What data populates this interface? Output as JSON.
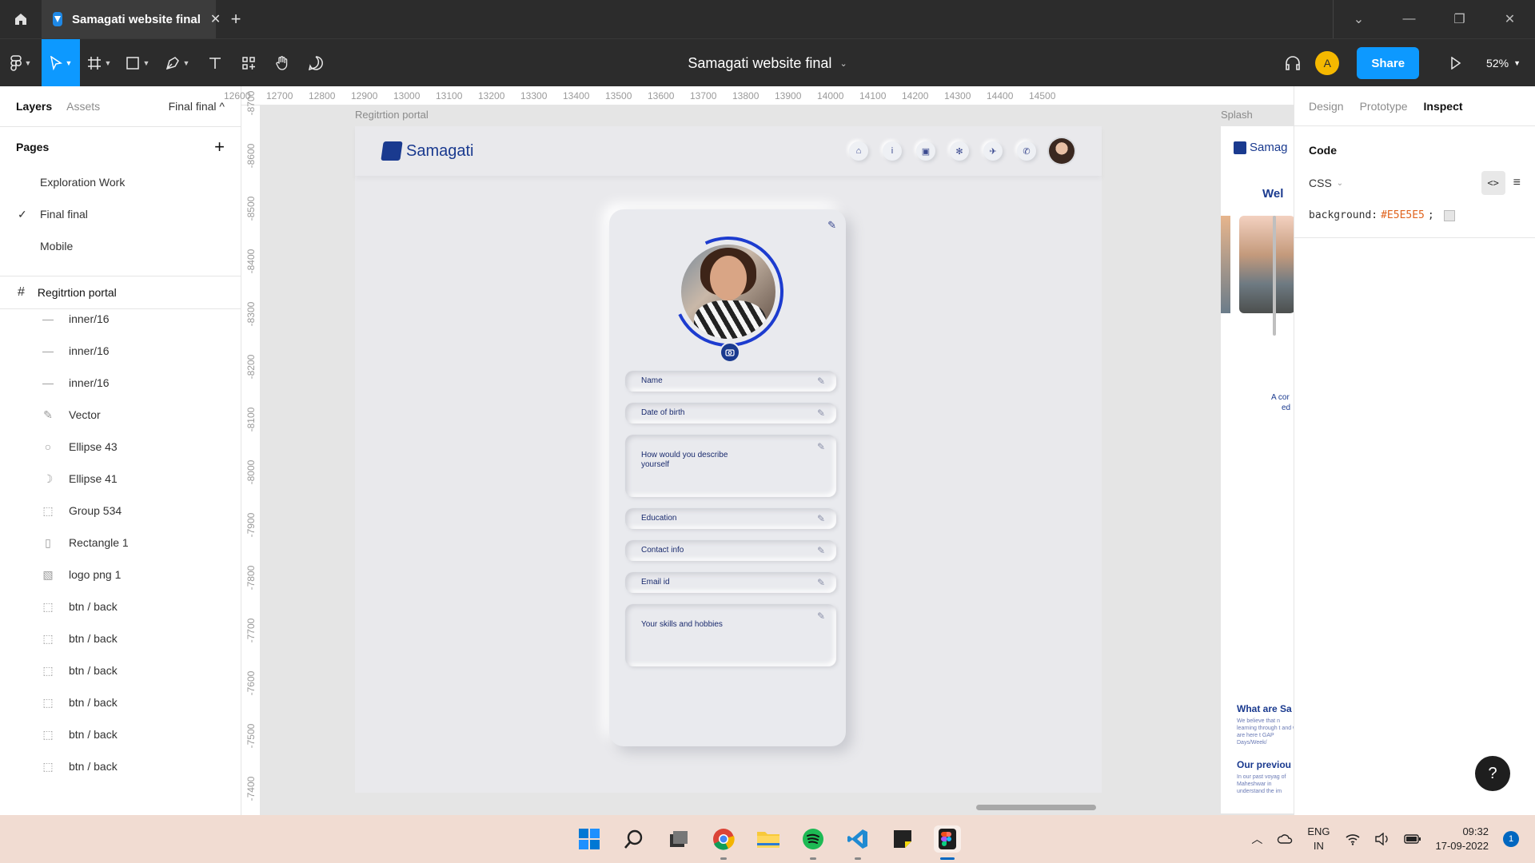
{
  "window": {
    "tab_title": "Samagati website final",
    "tab_close": "✕",
    "new_tab": "+",
    "controls": [
      "⌄",
      "—",
      "❐",
      "✕"
    ]
  },
  "toolbar": {
    "doc_title": "Samagati website final",
    "avatar_initial": "A",
    "share_label": "Share",
    "zoom": "52%"
  },
  "left_panel": {
    "tabs": [
      "Layers",
      "Assets"
    ],
    "page_selector": "Final final ^",
    "pages_header": "Pages",
    "pages": [
      {
        "label": "Exploration Work",
        "selected": false
      },
      {
        "label": "Final final",
        "selected": true
      },
      {
        "label": "Mobile",
        "selected": false
      }
    ],
    "frame_name": "Regitrtion portal",
    "layers": [
      {
        "label": "inner/16",
        "icon": "line-icon"
      },
      {
        "label": "inner/16",
        "icon": "line-icon"
      },
      {
        "label": "inner/16",
        "icon": "line-icon"
      },
      {
        "label": "Vector",
        "icon": "pen-icon"
      },
      {
        "label": "Ellipse 43",
        "icon": "ellipse-icon"
      },
      {
        "label": "Ellipse 41",
        "icon": "arc-icon"
      },
      {
        "label": "Group 534",
        "icon": "group-icon"
      },
      {
        "label": "Rectangle 1",
        "icon": "rectangle-icon"
      },
      {
        "label": "logo png 1",
        "icon": "image-icon"
      },
      {
        "label": "btn / back",
        "icon": "group-icon"
      },
      {
        "label": "btn / back",
        "icon": "group-icon"
      },
      {
        "label": "btn / back",
        "icon": "group-icon"
      },
      {
        "label": "btn / back",
        "icon": "group-icon"
      },
      {
        "label": "btn / back",
        "icon": "group-icon"
      },
      {
        "label": "btn / back",
        "icon": "group-icon"
      }
    ]
  },
  "rulers": {
    "top": [
      "12600",
      "12700",
      "12800",
      "12900",
      "13000",
      "13100",
      "13200",
      "13300",
      "13400",
      "13500",
      "13600",
      "13700",
      "13800",
      "13900",
      "14000",
      "14100",
      "14200",
      "14300",
      "14400",
      "14500"
    ],
    "left": [
      "-8700",
      "-8600",
      "-8500",
      "-8400",
      "-8300",
      "-8200",
      "-8100",
      "-8000",
      "-7900",
      "-7800",
      "-7700",
      "-7600",
      "-7500",
      "-7400"
    ]
  },
  "canvas": {
    "frame_label": "Regitrtion portal",
    "frame2_label": "Splash",
    "background": "#E5E5E5",
    "site": {
      "logo_text": "Samagati",
      "nav_icons": [
        "home-icon",
        "info-icon",
        "gallery-icon",
        "community-icon",
        "travel-icon",
        "phone-icon"
      ],
      "fields": [
        {
          "label": "Name",
          "tall": false
        },
        {
          "label": "Date of birth",
          "tall": false
        },
        {
          "label": "How would you describe yourself",
          "tall": true
        },
        {
          "label": "Education",
          "tall": false
        },
        {
          "label": "Contact info",
          "tall": false
        },
        {
          "label": "Email id",
          "tall": false
        },
        {
          "label": "Your skills and hobbies",
          "tall": true
        }
      ]
    },
    "splash_texts": [
      "Samag",
      "Wel",
      "A cor",
      "ed",
      "What are Sa",
      "We believe that n learning through t and we are here t GAP Days/Week/",
      "Our previou",
      "In our past voyag of Maheshwar in understand the im"
    ]
  },
  "right_panel": {
    "tabs": [
      "Design",
      "Prototype",
      "Inspect"
    ],
    "code_header": "Code",
    "language": "CSS",
    "css_property": "background:",
    "css_value": "#E5E5E5",
    "css_end": ";",
    "help": "?"
  },
  "taskbar": {
    "lang_top": "ENG",
    "lang_bottom": "IN",
    "time": "09:32",
    "date": "17-09-2022",
    "notifications": "1"
  }
}
